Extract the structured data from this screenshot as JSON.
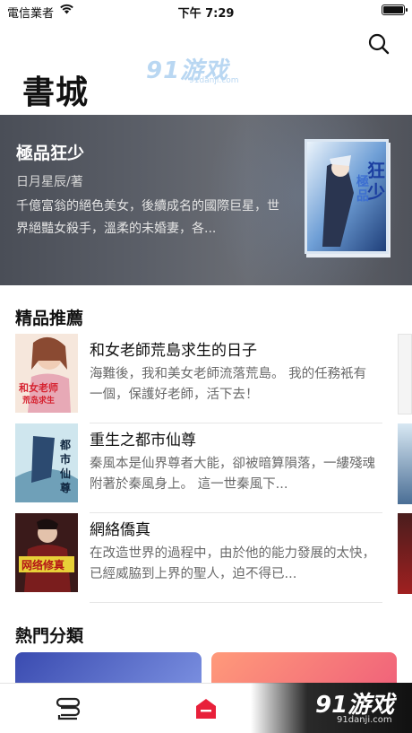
{
  "status_bar": {
    "carrier": "電信業者",
    "time": "下午 7:29"
  },
  "watermark": {
    "top_main": "91游戏",
    "top_sub": "91danji.com",
    "bottom_main": "91游戏",
    "bottom_sub": "91danji.com"
  },
  "page": {
    "title": "書城"
  },
  "featured": {
    "title": "極品狂少",
    "author": "日月星辰/著",
    "description": "千億富翁的絕色美女，後續成名的國際巨星，世界絕豔女殺手，溫柔的未婚妻，各...",
    "cover_icon": "book-cover-image"
  },
  "recommended": {
    "section_title": "精品推薦",
    "books": [
      {
        "title": "和女老師荒島求生的日子",
        "description": "海難後，我和美女老師流落荒島。 我的任務衹有一個，保護好老師，活下去！",
        "cover_text": "和女老师荒岛求生"
      },
      {
        "title": "重生之都市仙尊",
        "description": "秦風本是仙界尊者大能，卻被暗算隕落，一縷殘魂附著於秦風身上。    這一世秦風下...",
        "cover_text": "都市仙尊"
      },
      {
        "title": "網絡僑真",
        "description": "在改造世界的過程中，由於他的能力發展的太快，已經威脇到上界的聖人，迫不得已...",
        "cover_text": "网络修真"
      }
    ]
  },
  "categories": {
    "section_title": "熱門分類"
  },
  "tab_bar": {
    "shelf_icon": "bookshelf-icon",
    "store_icon": "bookstore-icon"
  },
  "colors": {
    "accent": "#e8203a",
    "featured_bg": "#565a62"
  }
}
